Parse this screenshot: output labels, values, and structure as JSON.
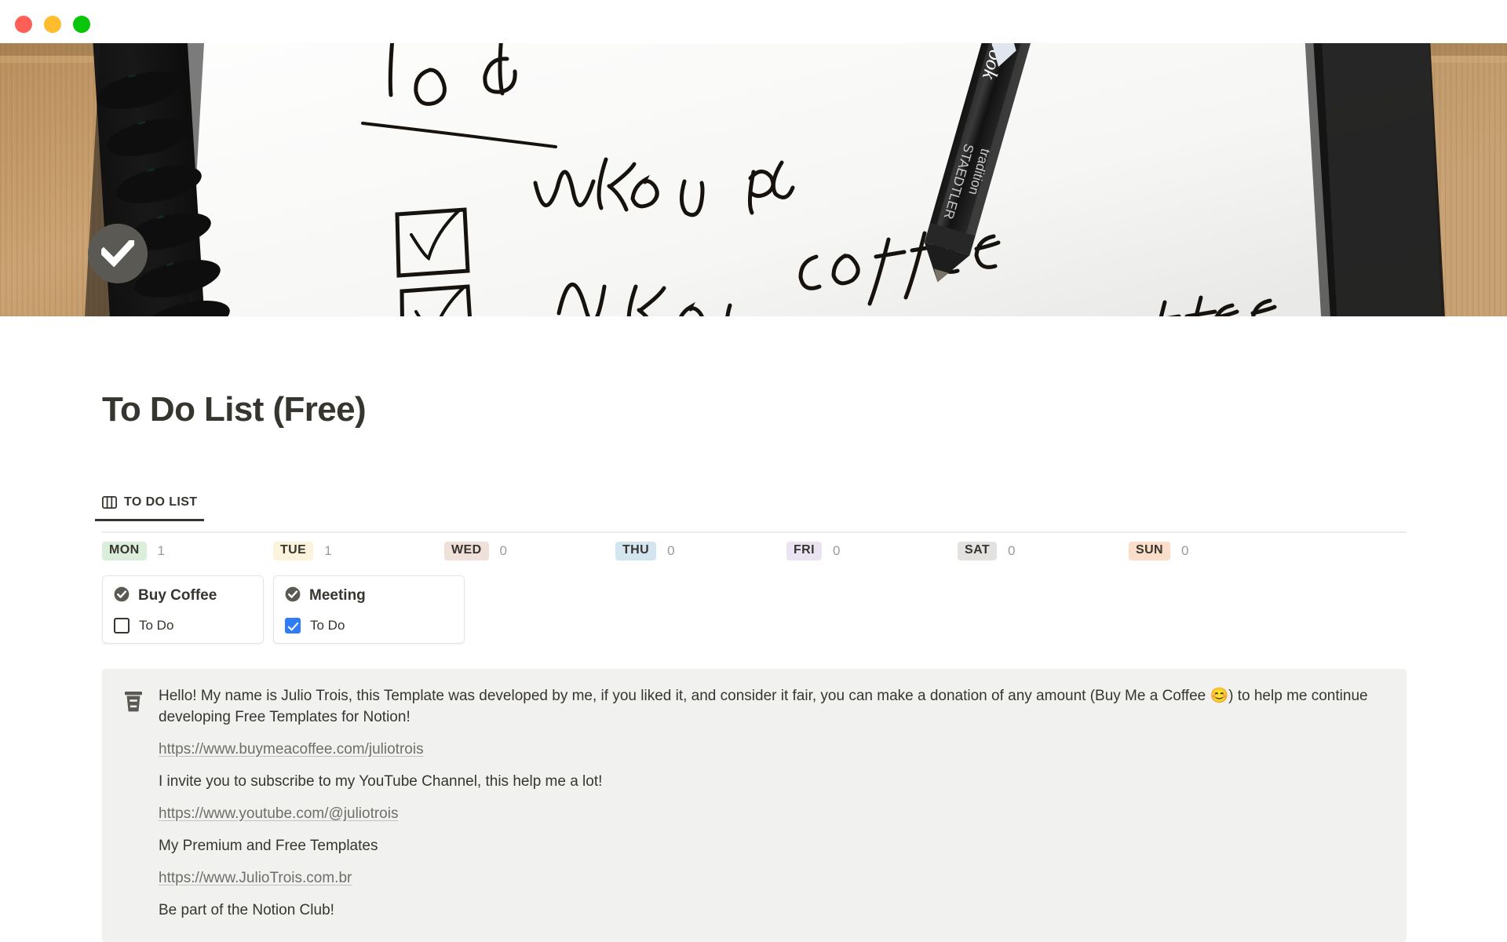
{
  "window": {
    "controls": [
      {
        "name": "close",
        "color": "#ff5f57"
      },
      {
        "name": "minimize",
        "color": "#ffbd2e"
      },
      {
        "name": "maximize",
        "color": "#0ac60a"
      }
    ]
  },
  "cover": {
    "description": "Spiral notebook on wooden desk with handwritten to-do list and black pencil",
    "handwriting": [
      "To do",
      "Wake up",
      "Make coffee",
      "Drink coffee",
      "coffee"
    ],
    "pencil_brand": "Bambook",
    "pencil_brand2": "STAEDTLER"
  },
  "page": {
    "icon": "check-circle-icon",
    "icon_color": "#5b5953",
    "title": "To Do List (Free)"
  },
  "tabs": [
    {
      "label": "TO DO LIST",
      "icon": "board-view-icon",
      "active": true
    }
  ],
  "board": {
    "columns": [
      {
        "day": "MON",
        "count": "1",
        "pill_color": "#dbeddb",
        "cards": [
          {
            "icon": "check-circle-icon",
            "title": "Buy Coffee",
            "prop_label": "To Do",
            "checked": false
          }
        ]
      },
      {
        "day": "TUE",
        "count": "1",
        "pill_color": "#fbf3db",
        "cards": [
          {
            "icon": "check-circle-icon",
            "title": "Meeting",
            "prop_label": "To Do",
            "checked": true
          }
        ]
      },
      {
        "day": "WED",
        "count": "0",
        "pill_color": "#f0e0da",
        "cards": []
      },
      {
        "day": "THU",
        "count": "0",
        "pill_color": "#d3e5ef",
        "cards": []
      },
      {
        "day": "FRI",
        "count": "0",
        "pill_color": "#eae4f2",
        "cards": []
      },
      {
        "day": "SAT",
        "count": "0",
        "pill_color": "#e3e2e0",
        "cards": []
      },
      {
        "day": "SUN",
        "count": "0",
        "pill_color": "#fadec9",
        "cards": []
      }
    ]
  },
  "callout": {
    "icon": "coffee-cup-icon",
    "background": "#f1f1ef",
    "paragraph1": "Hello! My name is Julio Trois, this Template was developed by me, if you liked it, and consider it fair, you can make a donation of any amount (Buy Me a Coffee 😊) to help me continue developing Free Templates for Notion!",
    "link1": "https://www.buymeacoffee.com/juliotrois",
    "paragraph2": "I invite you to subscribe to my YouTube Channel, this help me a lot!",
    "link2": "https://www.youtube.com/@juliotrois",
    "paragraph3": "My Premium and Free Templates",
    "link3": "https://www.JulioTrois.com.br",
    "paragraph4": "Be part of the Notion Club!"
  }
}
